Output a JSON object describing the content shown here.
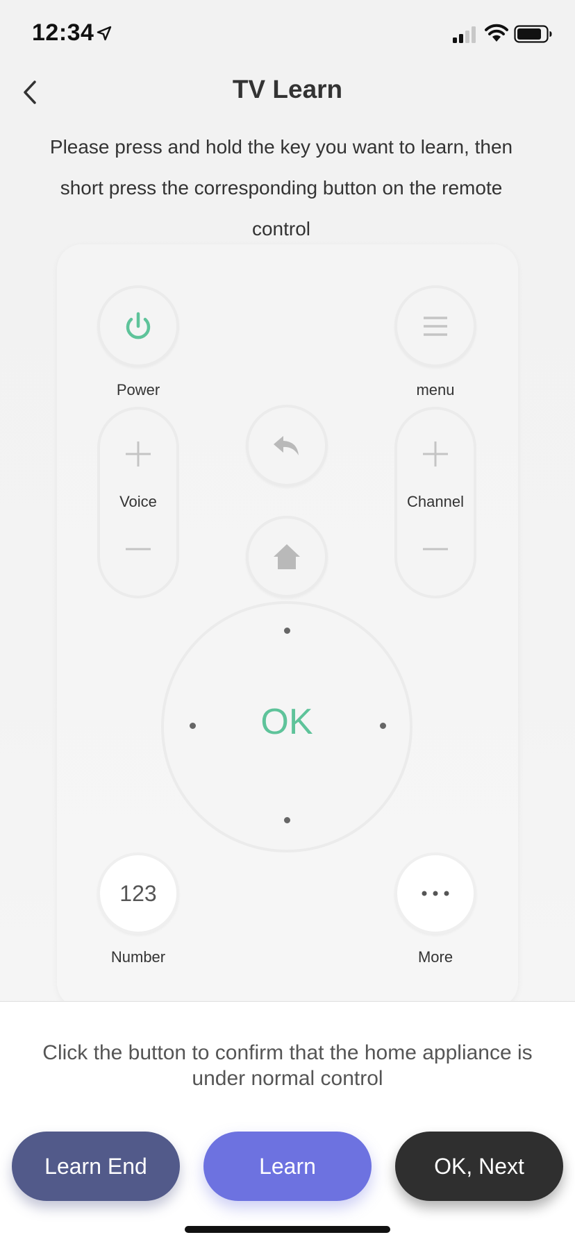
{
  "status_bar": {
    "time": "12:34"
  },
  "header": {
    "title": "TV Learn"
  },
  "instruction": "Please press and hold the key you want to learn, then short press the corresponding button on the remote control",
  "remote": {
    "power_label": "Power",
    "menu_label": "menu",
    "voice_label": "Voice",
    "channel_label": "Channel",
    "ok_label": "OK",
    "number_text": "123",
    "number_label": "Number",
    "more_label": "More"
  },
  "bottom": {
    "confirm_text": "Click the button to confirm that the home appliance is under normal control",
    "learn_end_label": "Learn End",
    "learn_label": "Learn",
    "next_label": "OK, Next"
  },
  "colors": {
    "accent_green": "#5ec39a",
    "learn_end": "#525a8a",
    "learn": "#6d72e0",
    "next": "#2f2f2f"
  },
  "icons": {
    "location": "location-arrow-icon",
    "signal": "cellular-signal-icon",
    "wifi": "wifi-icon",
    "battery": "battery-icon",
    "back": "chevron-left-icon",
    "power": "power-icon",
    "menu": "hamburger-menu-icon",
    "return": "return-arrow-icon",
    "home": "home-icon",
    "more": "ellipsis-icon"
  }
}
